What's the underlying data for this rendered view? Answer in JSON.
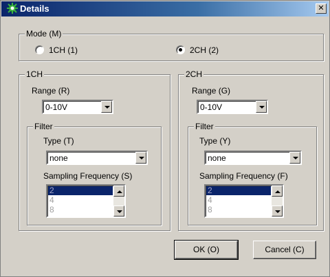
{
  "window": {
    "title": "Details",
    "close_glyph": "✕"
  },
  "mode": {
    "legend": "Mode (M)",
    "options": [
      {
        "label": "1CH (1)",
        "checked": false
      },
      {
        "label": "2CH (2)",
        "checked": true
      }
    ]
  },
  "ch1": {
    "legend": "1CH",
    "range_label": "Range (R)",
    "range_value": "0-10V",
    "filter": {
      "legend": "Filter",
      "type_label": "Type (T)",
      "type_value": "none",
      "sampling_label": "Sampling Frequency (S)",
      "sampling_items": [
        "2",
        "4",
        "8"
      ],
      "selected_index": 0
    }
  },
  "ch2": {
    "legend": "2CH",
    "range_label": "Range (G)",
    "range_value": "0-10V",
    "filter": {
      "legend": "Filter",
      "type_label": "Type (Y)",
      "type_value": "none",
      "sampling_label": "Sampling Frequency (F)",
      "sampling_items": [
        "2",
        "4",
        "8"
      ],
      "selected_index": 0
    }
  },
  "buttons": {
    "ok": "OK (O)",
    "cancel": "Cancel (C)"
  },
  "colors": {
    "titlebar": "#0a246a",
    "face": "#d4d0c8",
    "selection": "#0a246a"
  },
  "icons": {
    "title": "gear-icon",
    "close": "close-icon"
  }
}
